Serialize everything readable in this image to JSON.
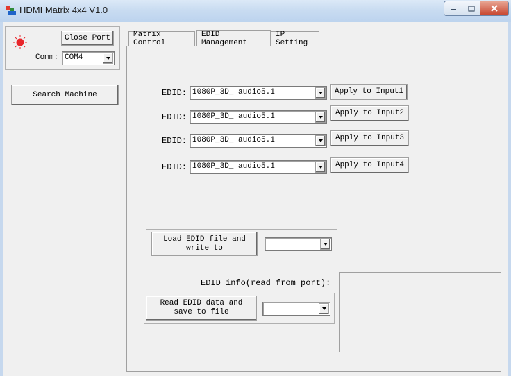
{
  "window": {
    "title": "HDMI Matrix 4x4 V1.0"
  },
  "connection": {
    "close_port_label": "Close Port",
    "comm_label": "Comm:",
    "comm_value": "COM4",
    "status_color": "#e8262b"
  },
  "search_machine_label": "Search Machine",
  "tabs": [
    {
      "label": "Matrix Control",
      "active": false
    },
    {
      "label": "EDID Management",
      "active": true
    },
    {
      "label": "IP Setting",
      "active": false
    }
  ],
  "edid_rows": [
    {
      "label": "EDID:",
      "value": "1080P_3D_ audio5.1",
      "button": "Apply to Input1"
    },
    {
      "label": "EDID:",
      "value": "1080P_3D_ audio5.1",
      "button": "Apply to Input2"
    },
    {
      "label": "EDID:",
      "value": "1080P_3D_ audio5.1",
      "button": "Apply to Input3"
    },
    {
      "label": "EDID:",
      "value": "1080P_3D_ audio5.1",
      "button": "Apply to Input4"
    }
  ],
  "load_edid": {
    "button_line1": "Load EDID file and",
    "button_line2": "write to",
    "select_value": ""
  },
  "edid_info_label": "EDID info(read from port):",
  "read_edid": {
    "button_line1": "Read EDID data and",
    "button_line2": "save to file",
    "select_value": ""
  }
}
